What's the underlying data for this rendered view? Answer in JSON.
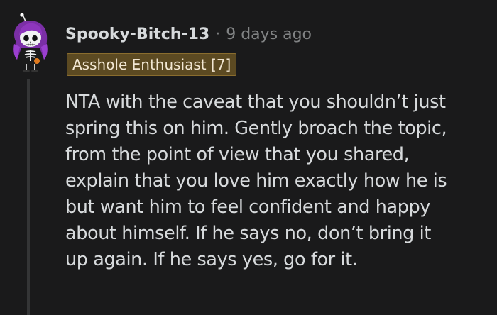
{
  "comment": {
    "username": "Spooky-Bitch-13",
    "separator": "·",
    "timestamp": "9 days ago",
    "flair": "Asshole Enthusiast [7]",
    "body_lines": [
      "NTA with the caveat that you shouldn’t just",
      "spring this on him. Gently broach the topic,",
      "from the point of view that you shared,",
      "explain that you love him exactly how he is",
      "but want him to feel confident and happy",
      "about himself. If he says no, don’t bring it",
      "up again. If he says yes, go for it."
    ]
  },
  "colors": {
    "background": "#1a1a1b",
    "text": "#d7dadc",
    "muted": "#818384",
    "flair_bg": "#5c4a22",
    "thread_line": "#343536"
  }
}
